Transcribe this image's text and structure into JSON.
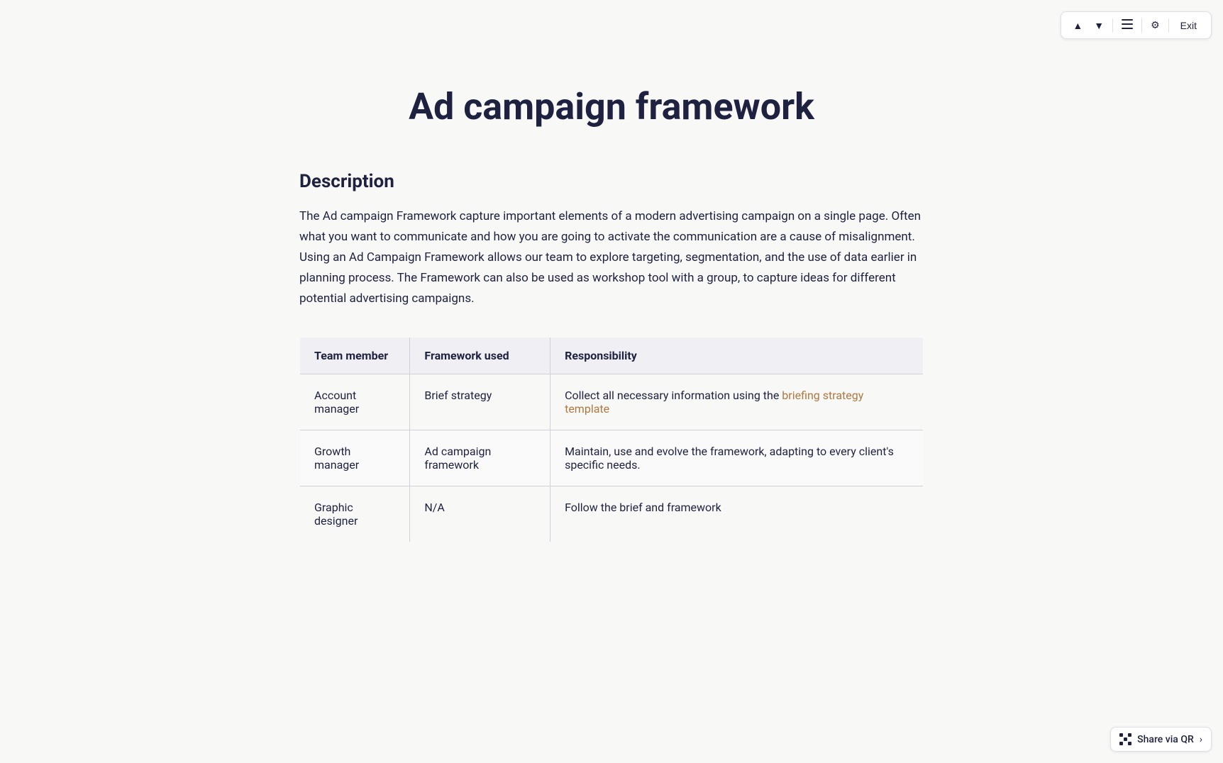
{
  "toolbar": {
    "chevron_up": "▲",
    "chevron_down": "▼",
    "list_icon": "☰",
    "settings_icon": "⚙",
    "exit_label": "Exit"
  },
  "page": {
    "title": "Ad campaign framework",
    "description_heading": "Description",
    "description_text": "The Ad campaign Framework capture important elements of a modern advertising campaign on a single page.  Often what you want to communicate and how you are going to activate the communication are a cause of misalignment.  Using an Ad Campaign Framework allows our team to explore targeting, segmentation, and the use of data earlier in planning process.  The Framework can also be used as workshop tool with a group, to capture ideas for different potential advertising campaigns.",
    "table": {
      "columns": [
        "Team member",
        "Framework used",
        "Responsibility"
      ],
      "rows": [
        {
          "team_member": "Account manager",
          "framework_used": "Brief strategy",
          "responsibility_text": "Collect all necessary information using the ",
          "link_text": "briefing strategy template",
          "responsibility_suffix": ""
        },
        {
          "team_member": "Growth manager",
          "framework_used": "Ad campaign framework",
          "responsibility_text": "Maintain, use and evolve the framework, adapting to every client's specific needs.",
          "link_text": "",
          "responsibility_suffix": ""
        },
        {
          "team_member": "Graphic designer",
          "framework_used": "N/A",
          "responsibility_text": "Follow the brief and framework",
          "link_text": "",
          "responsibility_suffix": ""
        }
      ]
    }
  },
  "share_bar": {
    "label": "Share via QR"
  }
}
